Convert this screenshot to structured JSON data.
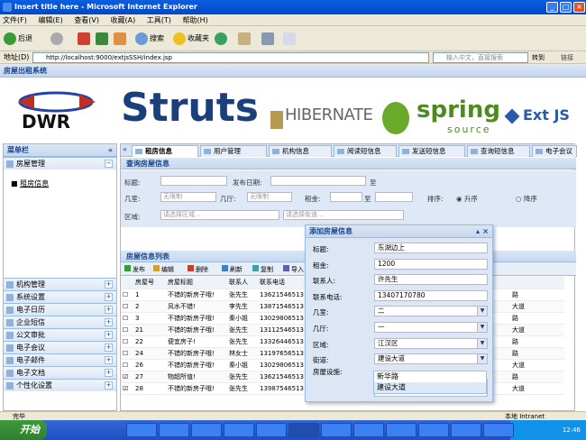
{
  "window": {
    "title": "Insert title here - Microsoft Internet Explorer"
  },
  "menu": [
    "文件(F)",
    "编辑(E)",
    "查看(V)",
    "收藏(A)",
    "工具(T)",
    "帮助(H)"
  ],
  "toolbar": {
    "back": "后退",
    "search": "搜索",
    "favorites": "收藏夹"
  },
  "address": {
    "label": "地址(D)",
    "url": "http://localhost:9000/extjsSSH/index.jsp",
    "search_placeholder": "输入中文，直接搜索",
    "go": "转到",
    "links": "链接"
  },
  "app": {
    "title": "房屋出租系统"
  },
  "banner": {
    "logos": [
      "DWR",
      "Struts",
      "HIBERNATE",
      "spring",
      "source",
      "Ext JS"
    ]
  },
  "sidebar": {
    "title": "菜单栏",
    "group_open": "房屋管理",
    "open_item": "租房信息",
    "groups": [
      "机构管理",
      "系统设置",
      "电子日历",
      "企业短信",
      "公文审批",
      "电子会议",
      "电子邮件",
      "电子文档",
      "个性化设置"
    ]
  },
  "tabs": [
    "租房信息",
    "用户管理",
    "机构信息",
    "阅读短信息",
    "发送短信息",
    "查询短信息",
    "电子会议"
  ],
  "query": {
    "section_title": "查询房屋信息",
    "title_label": "标题:",
    "date_label": "发布日期:",
    "date_sep": "至",
    "room_label": "几室:",
    "room_ph": "无限制",
    "hall_label": "几厅:",
    "hall_ph": "无限制",
    "rent_label": "租金:",
    "sort_label": "排序:",
    "asc": "升序",
    "desc": "降序",
    "district_label": "区域:",
    "district_ph": "请选择区域...",
    "street_ph": "请选择街道..."
  },
  "grid": {
    "section_title": "房屋信息列表",
    "actions": [
      "发布",
      "编辑",
      "删除",
      "刷新",
      "复制",
      "导入"
    ],
    "headers": [
      "房屋号",
      "房屋标题",
      "联系人",
      "联系电话"
    ],
    "rows": [
      {
        "no": "1",
        "title": "不错的新房子哦!",
        "contact": "张先生",
        "phone": "13621546513",
        "street": "路",
        "checked": false
      },
      {
        "no": "2",
        "title": "风水不错!",
        "contact": "李先生",
        "phone": "13871546513",
        "street": "大道",
        "checked": false
      },
      {
        "no": "3",
        "title": "不错的新房子哦!",
        "contact": "秦小姐",
        "phone": "13029806513",
        "street": "路",
        "checked": false
      },
      {
        "no": "21",
        "title": "不错的新房子哦!",
        "contact": "张先生",
        "phone": "13112546513",
        "street": "大道",
        "checked": false
      },
      {
        "no": "22",
        "title": "便宜房子!",
        "contact": "张先生",
        "phone": "13326446513",
        "street": "路",
        "checked": false
      },
      {
        "no": "24",
        "title": "不错的新房子哦!",
        "contact": "林女士",
        "phone": "13197656513",
        "street": "路",
        "checked": false
      },
      {
        "no": "26",
        "title": "不错的新房子哦!",
        "contact": "秦小姐",
        "phone": "13029806513",
        "street": "大道",
        "checked": false
      },
      {
        "no": "27",
        "title": "物超所值!",
        "contact": "张先生",
        "phone": "13621546513",
        "street": "路",
        "checked": true
      },
      {
        "no": "28",
        "title": "不错的新房子哦!",
        "contact": "张先生",
        "phone": "13987546513",
        "street": "大道",
        "checked": true
      }
    ]
  },
  "dialog": {
    "title": "添加房屋信息",
    "fields": [
      {
        "label": "标题:",
        "value": "东湖边上",
        "combo": false
      },
      {
        "label": "租金:",
        "value": "1200",
        "combo": false
      },
      {
        "label": "联系人:",
        "value": "许先生",
        "combo": false
      },
      {
        "label": "联系电话:",
        "value": "13407170780",
        "combo": false
      },
      {
        "label": "几室:",
        "value": "二",
        "combo": true
      },
      {
        "label": "几厅:",
        "value": "一",
        "combo": true
      },
      {
        "label": "区域:",
        "value": "江汉区",
        "combo": true
      },
      {
        "label": "街道:",
        "value": "建设大道",
        "combo": true
      }
    ],
    "facility_label": "房屋设施:",
    "dropdown_options": [
      "新华路",
      "建设大道"
    ]
  },
  "status": {
    "text": "完毕",
    "zone": "本地 Intranet"
  },
  "taskbar": {
    "start": "开始",
    "clock": "12:46",
    "tasks": [
      "",
      "",
      "",
      "",
      "",
      "",
      "",
      "",
      "",
      "",
      "",
      ""
    ]
  }
}
